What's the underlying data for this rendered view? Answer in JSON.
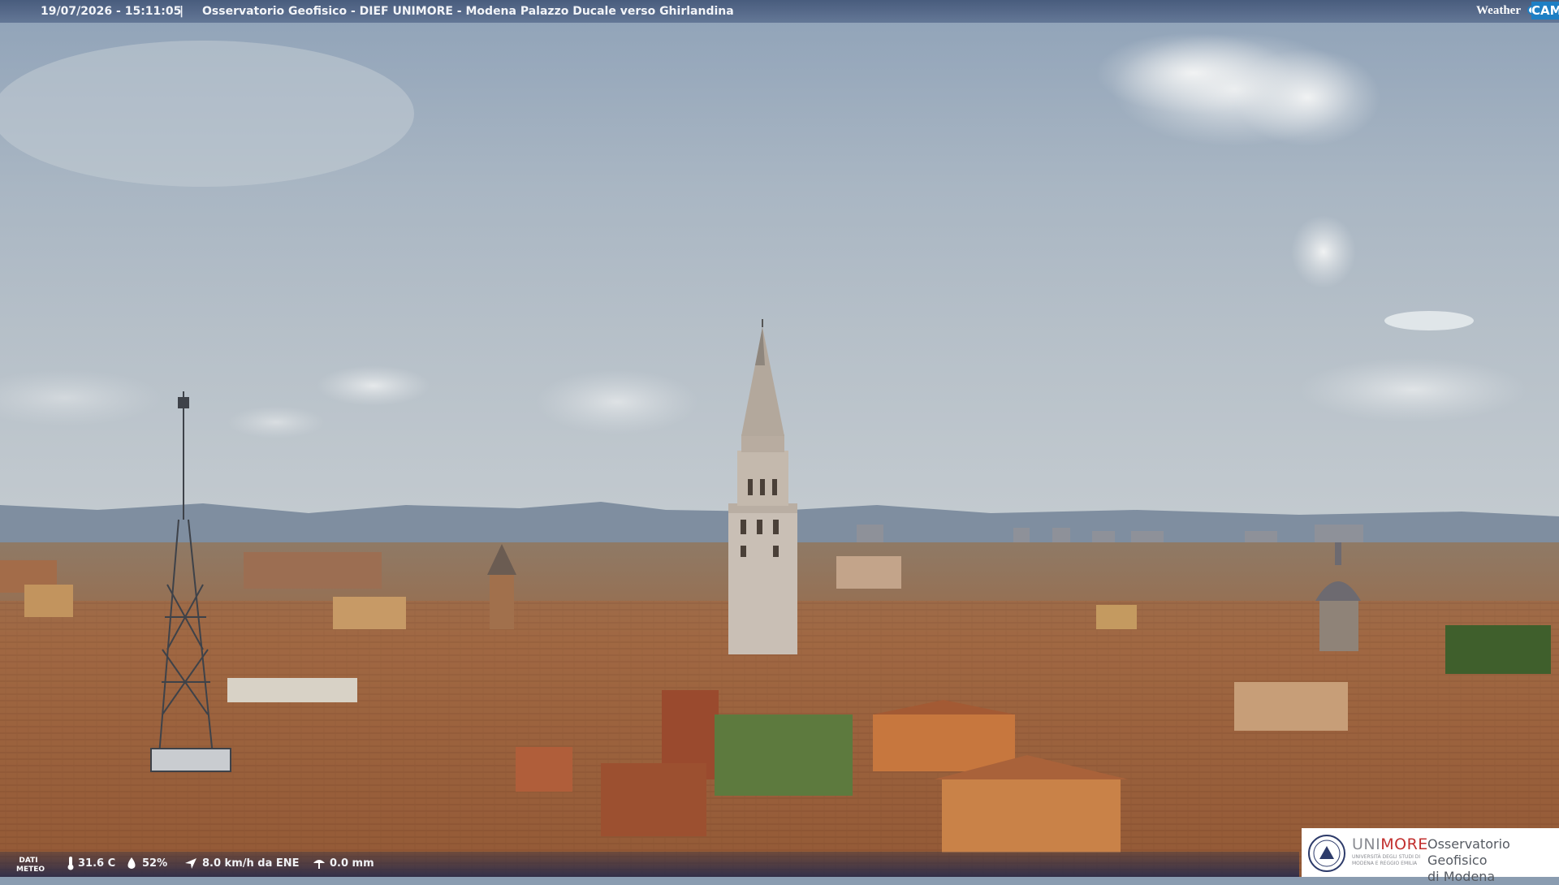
{
  "overlay_top": {
    "datetime": "19/07/2026 - 15:11:05",
    "separator": "|",
    "title": "Osservatorio Geofisico - DIEF UNIMORE - Modena Palazzo Ducale verso Ghirlandina"
  },
  "brand_logo": {
    "word": "Weather",
    "cam": "CAM"
  },
  "overlay_bottom": {
    "label_line1": "DATI",
    "label_line2": "METEO",
    "temperature": "31.6 C",
    "humidity": "52%",
    "wind": "8.0 km/h da ENE",
    "rain": "0.0 mm",
    "icons": [
      "thermometer-icon",
      "humidity-drop-icon",
      "wind-icon",
      "rain-icon"
    ]
  },
  "institution_logo": {
    "name_part1": "UNI",
    "name_part2": "MORE",
    "subtitle": "UNIVERSITÀ DEGLI STUDI DI MODENA E REGGIO EMILIA",
    "observatory_line1": "Osservatorio Geofisico",
    "observatory_line2": "di Modena"
  },
  "colors": {
    "sky": "#a4b3c2",
    "roof": "#a5663e",
    "tower": "#c9bfb5",
    "unimore_red": "#c2302f",
    "weathercam_blue": "#1e7fc4"
  }
}
